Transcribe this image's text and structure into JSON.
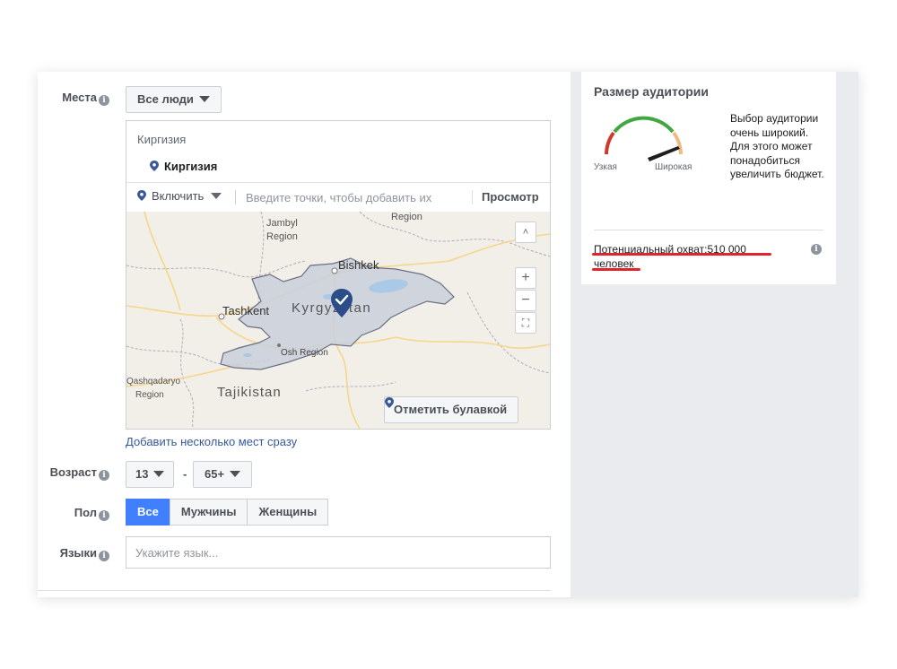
{
  "locations": {
    "label": "Места",
    "scope_dropdown": "Все люди",
    "header": "Киргизия",
    "selected_item": "Киргизия",
    "include_dropdown": "Включить",
    "input_placeholder": "Введите точки, чтобы добавить их",
    "browse_label": "Просмотр",
    "drop_pin_label": "Отметить булавкой",
    "add_multiple_link": "Добавить несколько мест сразу",
    "map_labels": {
      "jambyl": "Jambyl",
      "jambyl2": "Region",
      "region_top": "Region",
      "bishkek": "Bishkek",
      "kyrgyzstan": "Kyrgyzstan",
      "tashkent": "Tashkent",
      "osh": "Osh Region",
      "qashqadaryo": "Qashqadaryo",
      "qashqadaryo2": "Region",
      "tajikistan": "Tajikistan"
    },
    "zoom_in": "+",
    "zoom_out": "−",
    "collapse": "˄",
    "fullscreen": "⛶"
  },
  "age": {
    "label": "Возраст",
    "min": "13",
    "dash": "-",
    "max": "65+"
  },
  "gender": {
    "label": "Пол",
    "options": [
      "Все",
      "Мужчины",
      "Женщины"
    ],
    "selected": "Все"
  },
  "languages": {
    "label": "Языки",
    "placeholder": "Укажите язык..."
  },
  "audience": {
    "title": "Размер аудитории",
    "narrow_label": "Узкая",
    "wide_label": "Широкая",
    "description": "Выбор аудитории очень широкий. Для этого может понадобиться увеличить бюджет.",
    "reach_line1": "Потенциальный охват:510 000",
    "reach_line2": "человек"
  },
  "icons": {
    "info": "info-icon",
    "pin": "location-pin-icon",
    "caret": "caret-down-icon",
    "map_pin": "map-marker-check-icon"
  },
  "colors": {
    "primary": "#4080ff",
    "link": "#365899",
    "pin": "#3b5998",
    "underline": "#e0242d",
    "gauge_red": "#d0382b",
    "gauge_green": "#42a642",
    "gauge_orange": "#f0b97f"
  }
}
